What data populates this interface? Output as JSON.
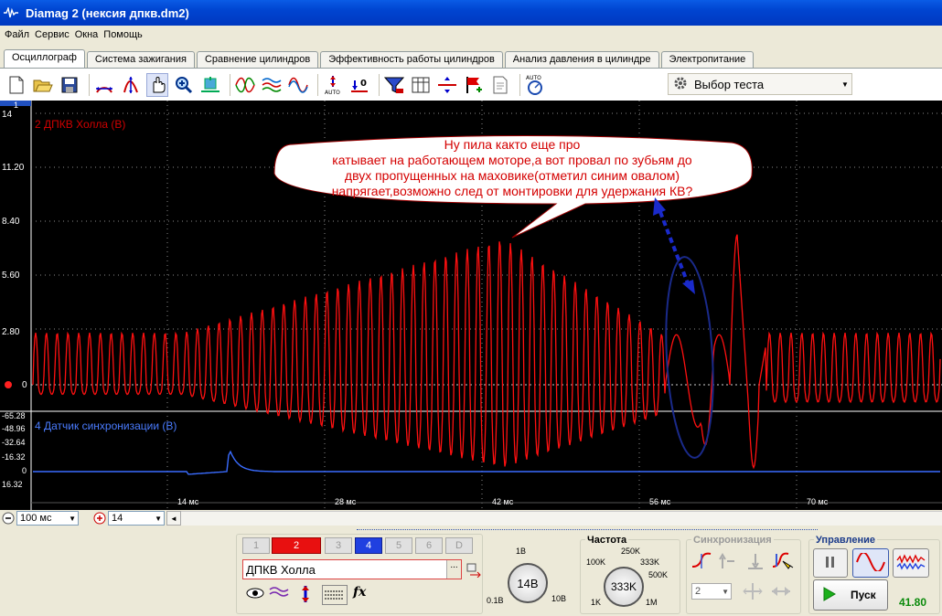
{
  "window": {
    "title": "Diamag 2 (нексия дпкв.dm2)"
  },
  "menu": [
    "Файл",
    "Сервис",
    "Окна",
    "Помощь"
  ],
  "tabs": [
    "Осциллограф",
    "Система зажигания",
    "Сравнение цилиндров",
    "Эффективность работы цилиндров",
    "Анализ давления в цилиндре",
    "Электропитание"
  ],
  "toolbar": {
    "icons": [
      "new-file-icon",
      "open-folder-icon",
      "save-icon",
      "zoom-fit-icon",
      "vertical-scale-icon",
      "hand-pan-icon",
      "zoom-icon",
      "auto-fit-icon",
      "sine-compare-icon",
      "waves-icon",
      "waves-multi-icon",
      "auto-scale-icon",
      "zero-offset-icon",
      "filter-icon",
      "table-icon",
      "cursor-icon",
      "marker-flag-icon",
      "notes-icon",
      "auto-meter-icon"
    ],
    "test_select": "Выбор теста"
  },
  "scope": {
    "ch2_label": "2 ДПКВ Холла (В)",
    "ch4_label": "4 Датчик синхронизации (В)",
    "y_ticks_ch2": [
      "14",
      "11.20",
      "8.40",
      "5.60",
      "2.80",
      "0"
    ],
    "y_ticks_ch4": [
      "-65.28",
      "-48.96",
      "-32.64",
      "-16.32",
      "0",
      "16.32"
    ],
    "x_ticks": [
      "14 мс",
      "28 мс",
      "42 мс",
      "56 мс",
      "70 мс"
    ],
    "top_marker": "1",
    "annotation": [
      "Ну пила както еще про",
      "катывает на работающем моторе,а вот провал по зубьям  до",
      "двух пропущенных на маховике(отметил синим овалом)",
      "напрягает,возможно след от монтировки для удержания КВ?"
    ],
    "colors": {
      "ch2": "#ff1010",
      "ch4": "#3a6cff",
      "annotation_oval": "#1a2a8a",
      "grid": "#8a8a8a"
    }
  },
  "lower_strip": {
    "timebase": "100 мс",
    "channel_scale": "14"
  },
  "channel_panel": {
    "buttons": [
      "1",
      "2",
      "3",
      "4",
      "5",
      "6",
      "D"
    ],
    "selected": "2",
    "name": "ДПКВ Холла",
    "scale_top": "1В",
    "scale_left": "0.1В",
    "scale_right": "10В",
    "scale_value": "14В"
  },
  "frequency": {
    "title": "Частота",
    "labels": [
      "100K",
      "250K",
      "333K",
      "500K",
      "1K",
      "1M"
    ],
    "value": "333K"
  },
  "sync": {
    "title": "Синхронизация",
    "value": "2"
  },
  "control": {
    "title": "Управление",
    "start_label": "Пуск",
    "value": "41.80"
  }
}
